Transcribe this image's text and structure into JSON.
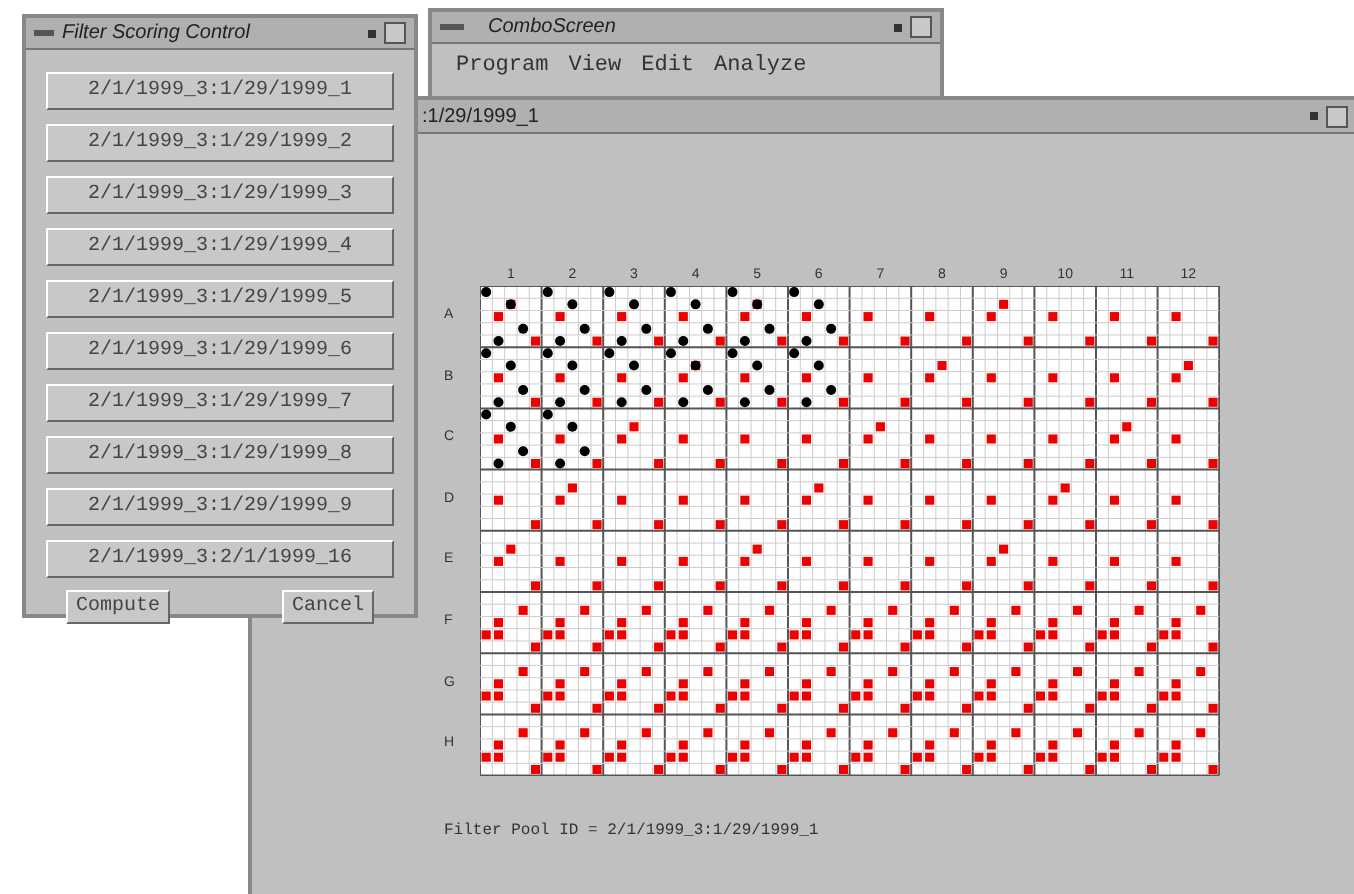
{
  "filter_window": {
    "title": "Filter Scoring Control",
    "pool_buttons": [
      "2/1/1999_3:1/29/1999_1",
      "2/1/1999_3:1/29/1999_2",
      "2/1/1999_3:1/29/1999_3",
      "2/1/1999_3:1/29/1999_4",
      "2/1/1999_3:1/29/1999_5",
      "2/1/1999_3:1/29/1999_6",
      "2/1/1999_3:1/29/1999_7",
      "2/1/1999_3:1/29/1999_8",
      "2/1/1999_3:1/29/1999_9",
      "2/1/1999_3:2/1/1999_16"
    ],
    "actions": [
      "Compute",
      "Cancel"
    ]
  },
  "combo_window": {
    "title": "ComboScreen",
    "menu": [
      "Program",
      "View",
      "Edit",
      "Analyze"
    ]
  },
  "plate_window": {
    "title": ":1/29/1999_1",
    "column_labels": [
      "1",
      "2",
      "3",
      "4",
      "5",
      "6",
      "7",
      "8",
      "9",
      "10",
      "11",
      "12"
    ],
    "row_labels": [
      "A",
      "B",
      "C",
      "D",
      "E",
      "F",
      "G",
      "H"
    ],
    "footer": "Filter Pool ID = 2/1/1999_3:1/29/1999_1"
  }
}
